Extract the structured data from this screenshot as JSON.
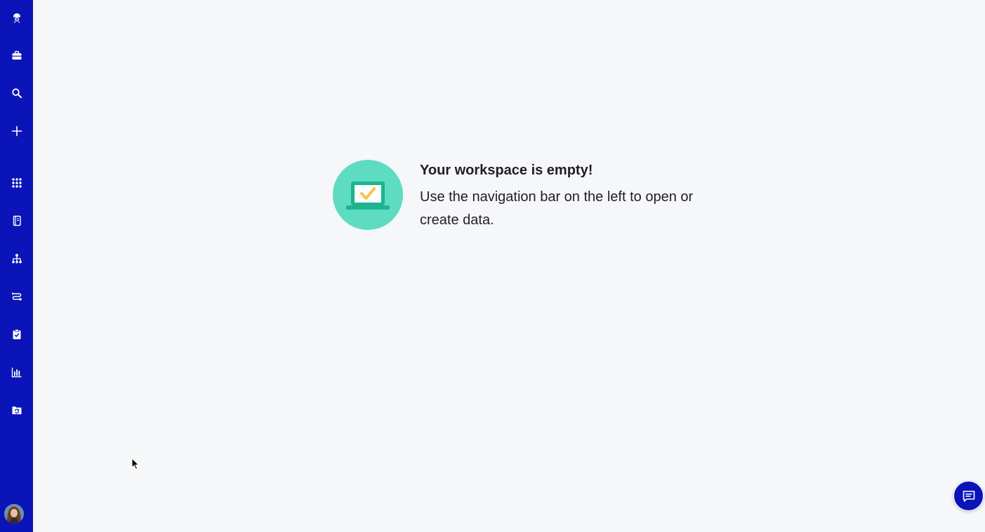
{
  "theme": {
    "accent": "#0b14b8",
    "illustration_bg": "#5edcc2",
    "illustration_laptop": "#1bb48f",
    "illustration_check": "#f6c44a"
  },
  "sidebar": {
    "items": [
      {
        "icon": "astronaut-logo-icon"
      },
      {
        "icon": "briefcase-icon"
      },
      {
        "icon": "search-icon"
      },
      {
        "icon": "plus-icon"
      },
      {
        "icon": "apps-grid-icon"
      },
      {
        "icon": "notebook-icon"
      },
      {
        "icon": "hierarchy-icon"
      },
      {
        "icon": "flow-icon"
      },
      {
        "icon": "clipboard-check-icon"
      },
      {
        "icon": "bar-chart-icon"
      },
      {
        "icon": "folder-sync-icon"
      }
    ],
    "avatar": {
      "icon": "user-avatar"
    }
  },
  "empty_state": {
    "title": "Your workspace is empty!",
    "description": "Use the navigation bar on the left to open or create data.",
    "illustration": "laptop-check-icon"
  },
  "chat": {
    "icon": "chat-icon"
  }
}
